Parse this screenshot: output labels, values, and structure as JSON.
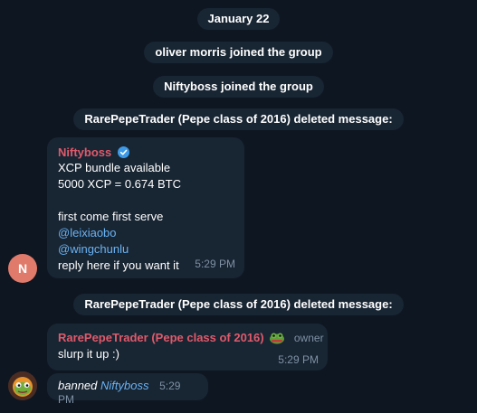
{
  "date_badge": "January 22",
  "service_messages": [
    "oliver morris joined the group",
    "Niftyboss joined the group",
    "RarePepeTrader (Pepe class of 2016) deleted message:",
    "RarePepeTrader (Pepe class of 2016) deleted message:"
  ],
  "msg1": {
    "sender": "Niftyboss",
    "lines": [
      "XCP bundle available",
      "5000 XCP = 0.674 BTC",
      "first come first serve"
    ],
    "mentions": [
      "@leixiaobo",
      "@wingchunlu"
    ],
    "last_line": "reply here if you want it",
    "time": "5:29 PM",
    "avatar_letter": "N"
  },
  "msg2": {
    "sender": "RarePepeTrader (Pepe class of 2016)",
    "role": "owner",
    "text": "slurp it up :)",
    "time": "5:29 PM"
  },
  "msg3": {
    "action": "banned",
    "target": "Niftyboss",
    "time": "5:29 PM"
  },
  "colors": {
    "background": "#0e1621",
    "bubble": "#182533",
    "sender_name": "#e05a6b",
    "link": "#6ab3f3",
    "meta": "#7f91a4",
    "verified": "#3d9ae8"
  },
  "icons": {
    "verified": "verified-badge-icon",
    "sticker_badge": "pepe-emoji-icon"
  }
}
